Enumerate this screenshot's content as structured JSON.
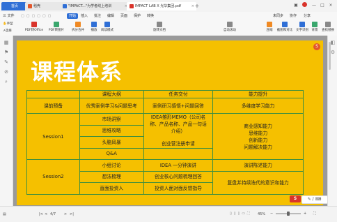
{
  "tabs": {
    "home": "首页",
    "t1": "稻壳",
    "t2": "\"IMPACT...\"为学者线上培训",
    "t3": "IMPACT LAB X 光华集团.pdf",
    "new": "+"
  },
  "menu": {
    "file": "三 文件",
    "start": "开始",
    "insert": "插入",
    "annotate": "批注",
    "edit": "编辑",
    "page": "页面",
    "protect": "保护",
    "convert": "转换",
    "search_placeholder": "查找功能、文档内容",
    "unsync": "未同步",
    "collab": "协作",
    "share": "分享"
  },
  "toolbar": {
    "hand": "手型",
    "select": "选择",
    "pdf_to_office": "PDF转Office",
    "pdf_to_img": "PDF转图片",
    "split_merge": "拆分合并",
    "play": "播放",
    "read_mode": "阅读模式",
    "zoom": "44.82%",
    "rotate": "旋转文档",
    "single": "单页",
    "double": "双页",
    "continuous": "连续阅读",
    "auto_scroll": "自动滚动",
    "page": "4/7",
    "highlight_words": "划词翻译",
    "full_translate": "全文翻译",
    "compress": "压缩",
    "screenshot_compare": "截图和对比",
    "text_recognition": "文字识别",
    "background": "背景",
    "find_replace": "查找替换"
  },
  "slide": {
    "title": "课程体系",
    "badge": "S",
    "table": {
      "headers": [
        "",
        "课程大纲",
        "任务交付",
        "能力提升"
      ],
      "prep": {
        "stage": "课前预备",
        "outline": "优秀案例学习&问题思考",
        "task": "案例研习感悟+问题回答",
        "skill": "多维度学习能力"
      },
      "session1": {
        "stage": "Session1",
        "outlines": [
          "市场洞察",
          "思维攻略",
          "头脑风暴",
          "Q&A"
        ],
        "task1": "IDEA雏形MEMO（公司名称、产品名称、产品一句话介绍）",
        "task2": "创业营注册申请",
        "skills": [
          "商业感知能力",
          "思维能力",
          "创新能力",
          "问题解决能力"
        ]
      },
      "session2": {
        "stage": "Session2",
        "outlines": [
          "小组讨论",
          "想法梳理",
          "直面投资人"
        ],
        "tasks": [
          "IDEA 一分钟演讲",
          "创业核心问题梳理回答",
          "投资人面对面反馈指导"
        ],
        "skills": [
          "演讲陈述能力",
          "复盘并持续迭代的意识和能力"
        ]
      }
    }
  },
  "status": {
    "page": "4/7",
    "zoom": "45%",
    "prev": "<",
    "next": ">",
    "first": "|<",
    "last": ">|"
  },
  "colors": {
    "slide_bg": "#f5c000",
    "table_line": "#3f8f3f",
    "accent": "#2f6fd6"
  }
}
